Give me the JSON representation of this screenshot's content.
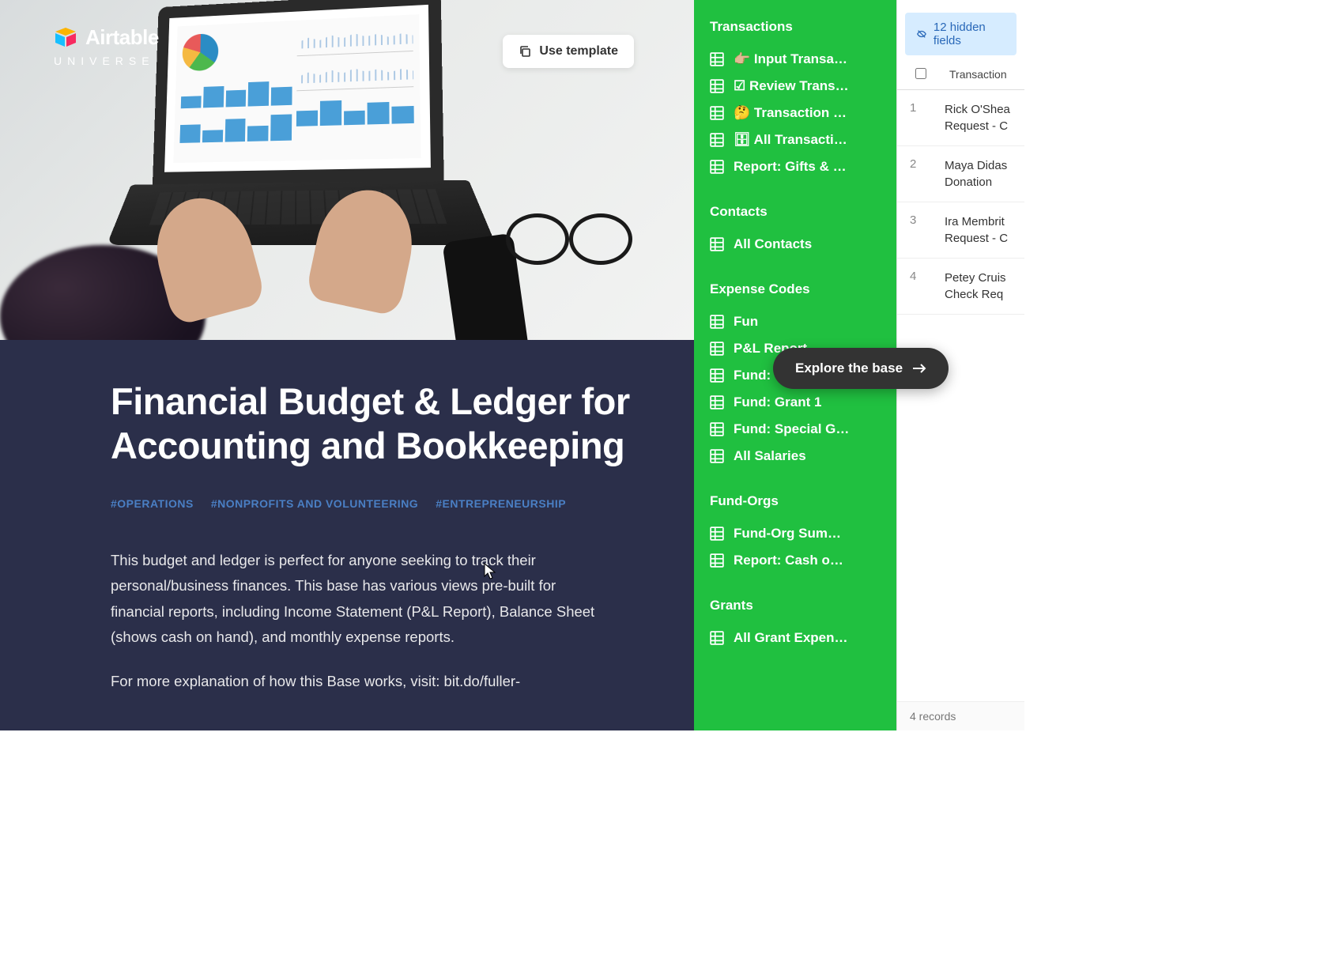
{
  "logo": {
    "brand": "Airtable",
    "sub": "UNIVERSE"
  },
  "use_template_label": "Use template",
  "title": "Financial Budget & Ledger for Accounting and Bookkeeping",
  "tags": [
    "#OPERATIONS",
    "#NONPROFITS AND VOLUNTEERING",
    "#ENTREPRENEURSHIP"
  ],
  "description_p1": "This budget and ledger is perfect for anyone seeking to track their personal/business finances. This base has various views pre-built for financial reports, including Income Statement (P&L Report), Balance Sheet (shows cash on hand), and monthly expense reports.",
  "description_p2": "For more explanation of how this Base works, visit: bit.do/fuller-",
  "explore_label": "Explore the base",
  "sidebar": {
    "sections": [
      {
        "heading": "Transactions",
        "items": [
          "👉🏼 Input Transa…",
          "☑ Review Trans…",
          "🤔 Transaction …",
          "🗄 All Transacti…",
          "Report: Gifts & …"
        ]
      },
      {
        "heading": "Contacts",
        "items": [
          "All Contacts"
        ]
      },
      {
        "heading": "Expense Codes",
        "items": [
          "Fun",
          "P&L Report",
          "Fund: General F…",
          "Fund: Grant 1",
          "Fund: Special G…",
          "All Salaries"
        ]
      },
      {
        "heading": "Fund-Orgs",
        "items": [
          "Fund-Org Sum…",
          "Report: Cash o…"
        ]
      },
      {
        "heading": "Grants",
        "items": [
          "All Grant Expen…"
        ]
      }
    ]
  },
  "hidden_fields": "12 hidden fields",
  "table": {
    "column": "Transaction",
    "rows": [
      {
        "n": "1",
        "text": "Rick O'Shea Request - C"
      },
      {
        "n": "2",
        "text": "Maya Didas Donation"
      },
      {
        "n": "3",
        "text": "Ira Membrit Request - C"
      },
      {
        "n": "4",
        "text": "Petey Cruis Check Req"
      }
    ],
    "footer": "4 records"
  }
}
